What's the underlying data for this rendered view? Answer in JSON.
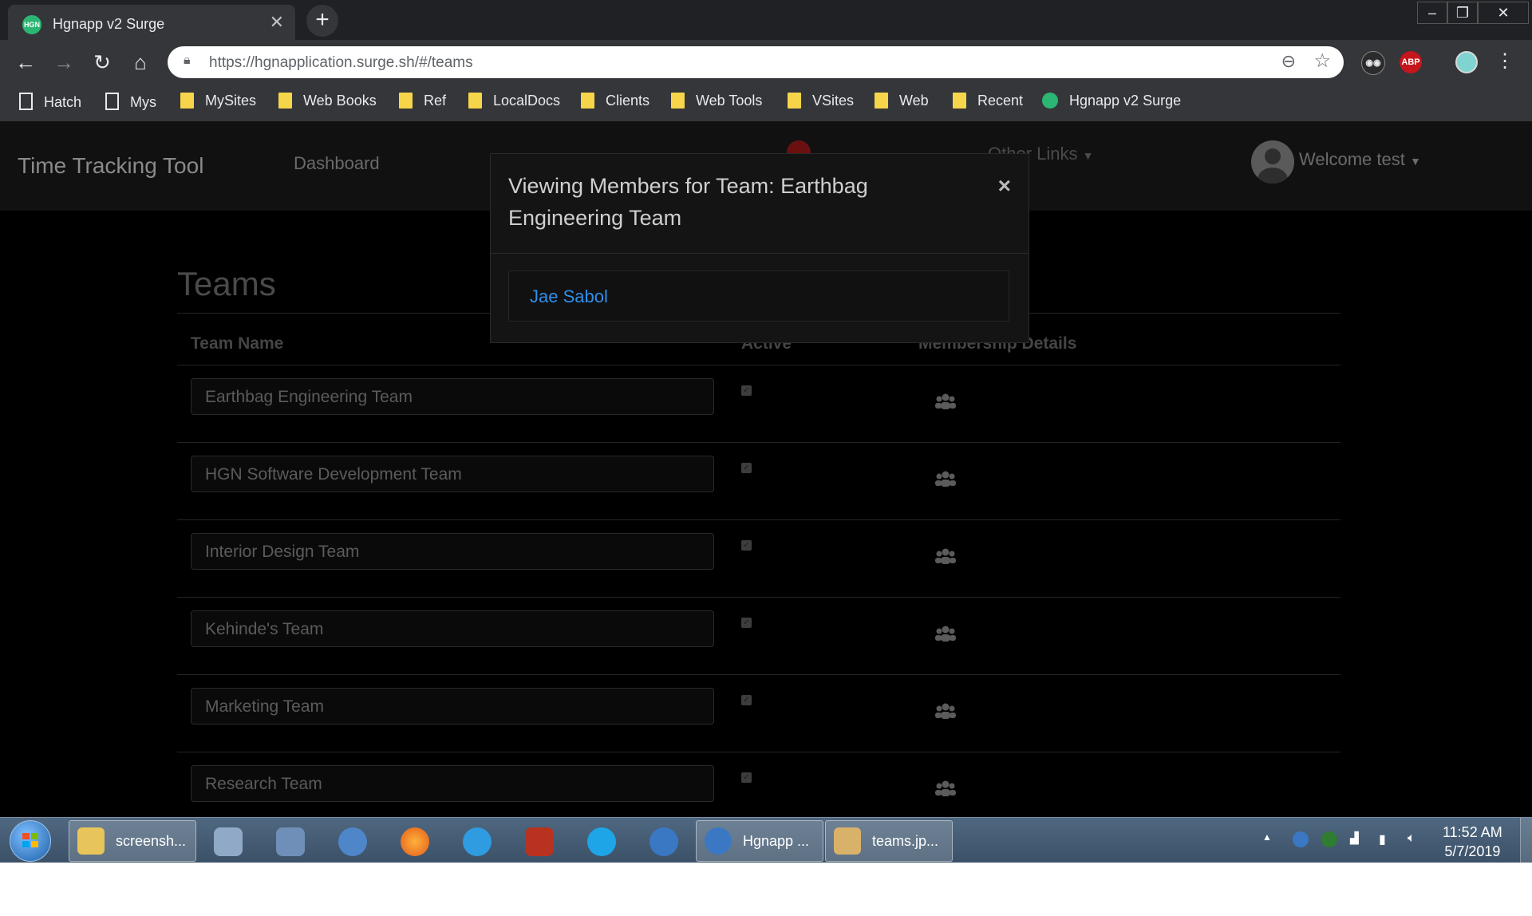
{
  "browser": {
    "tab_title": "Hgnapp v2 Surge",
    "favicon_text": "HGN",
    "url": "https://hgnapplication.surge.sh/#/teams",
    "ext_abp_label": "ABP",
    "bookmarks": [
      {
        "label": "Hatch",
        "type": "page"
      },
      {
        "label": "Mys",
        "type": "page"
      },
      {
        "label": "MySites",
        "type": "folder"
      },
      {
        "label": "Web Books",
        "type": "folder"
      },
      {
        "label": "Ref",
        "type": "folder"
      },
      {
        "label": "LocalDocs",
        "type": "folder"
      },
      {
        "label": "Clients",
        "type": "folder"
      },
      {
        "label": "Web Tools",
        "type": "folder"
      },
      {
        "label": "VSites",
        "type": "folder"
      },
      {
        "label": "Web",
        "type": "folder"
      },
      {
        "label": "Recent",
        "type": "folder"
      },
      {
        "label": "Hgnapp v2 Surge",
        "type": "favicon"
      }
    ]
  },
  "app": {
    "brand": "Time Tracking Tool",
    "nav_dashboard": "Dashboard",
    "nav_other_links": "Other Links",
    "welcome": "Welcome test"
  },
  "teams_page": {
    "title": "Teams",
    "columns": {
      "team_name": "Team Name",
      "active": "Active",
      "membership_details": "Membership Details"
    },
    "rows": [
      {
        "name": "Earthbag Engineering Team",
        "active": true
      },
      {
        "name": "HGN Software Development Team",
        "active": true
      },
      {
        "name": "Interior Design Team",
        "active": true
      },
      {
        "name": "Kehinde's Team",
        "active": true
      },
      {
        "name": "Marketing Team",
        "active": true
      },
      {
        "name": "Research Team",
        "active": true
      }
    ]
  },
  "modal": {
    "title": "Viewing Members for Team: Earthbag Engineering Team",
    "close_symbol": "×",
    "members": [
      "Jae Sabol"
    ]
  },
  "taskbar": {
    "windows": [
      {
        "label": "screensh...",
        "icon": "folder-icon"
      },
      {
        "label": "Hgnapp ...",
        "icon": "browser-icon"
      },
      {
        "label": "teams.jp...",
        "icon": "paint-icon"
      }
    ],
    "pinned_icons": [
      "computer-icon",
      "network-icon",
      "mail-icon",
      "firefox-icon",
      "ie-icon",
      "filezilla-icon",
      "skype-icon",
      "thunderbird-icon"
    ],
    "clock_time": "11:52 AM",
    "clock_date": "5/7/2019"
  },
  "colors": {
    "link_blue": "#2f8fea",
    "page_bg": "#000000",
    "navbar_bg": "#111111",
    "bookmark_folder": "#f7d54a"
  }
}
